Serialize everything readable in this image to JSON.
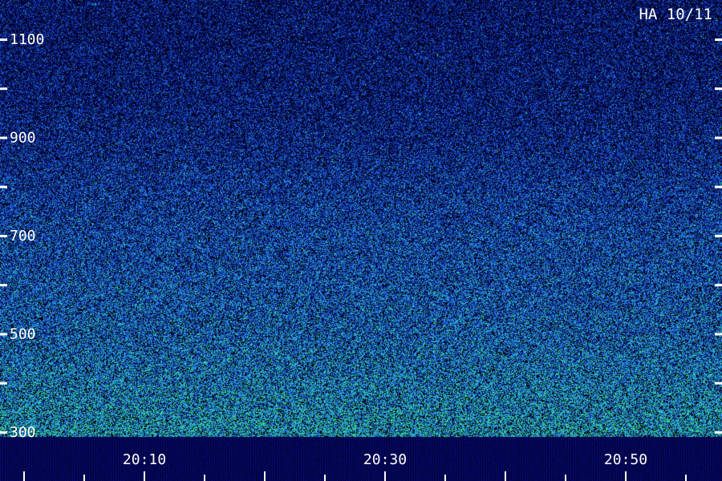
{
  "title": "HA 10/11",
  "chart_data": {
    "type": "heatmap",
    "title": "HA 10/11",
    "xlabel": "",
    "ylabel": "",
    "x_ticks": [
      {
        "label": "20:10",
        "minutes_after": 10
      },
      {
        "label": "20:30",
        "minutes_after": 30
      },
      {
        "label": "20:50",
        "minutes_after": 50
      }
    ],
    "x_minor_step_minutes": 5,
    "xlim_minutes": [
      -2,
      58
    ],
    "y_ticks": [
      {
        "label": "1100",
        "value": 1100
      },
      {
        "label": "900",
        "value": 900
      },
      {
        "label": "700",
        "value": 700
      },
      {
        "label": "500",
        "value": 500
      },
      {
        "label": "300",
        "value": 300
      }
    ],
    "y_minor_step": 100,
    "ylim": [
      290,
      1180
    ],
    "colormap": [
      "#000030",
      "#0a1a8a",
      "#1a4ad0",
      "#2aa0e0",
      "#30d890",
      "#50ff40"
    ],
    "intensity_by_frequency": [
      {
        "frequency": 300,
        "level": 0.62
      },
      {
        "frequency": 400,
        "level": 0.55
      },
      {
        "frequency": 500,
        "level": 0.48
      },
      {
        "frequency": 600,
        "level": 0.44
      },
      {
        "frequency": 700,
        "level": 0.4
      },
      {
        "frequency": 800,
        "level": 0.34
      },
      {
        "frequency": 900,
        "level": 0.27
      },
      {
        "frequency": 1000,
        "level": 0.22
      },
      {
        "frequency": 1100,
        "level": 0.2
      },
      {
        "frequency": 1180,
        "level": 0.18
      }
    ]
  }
}
